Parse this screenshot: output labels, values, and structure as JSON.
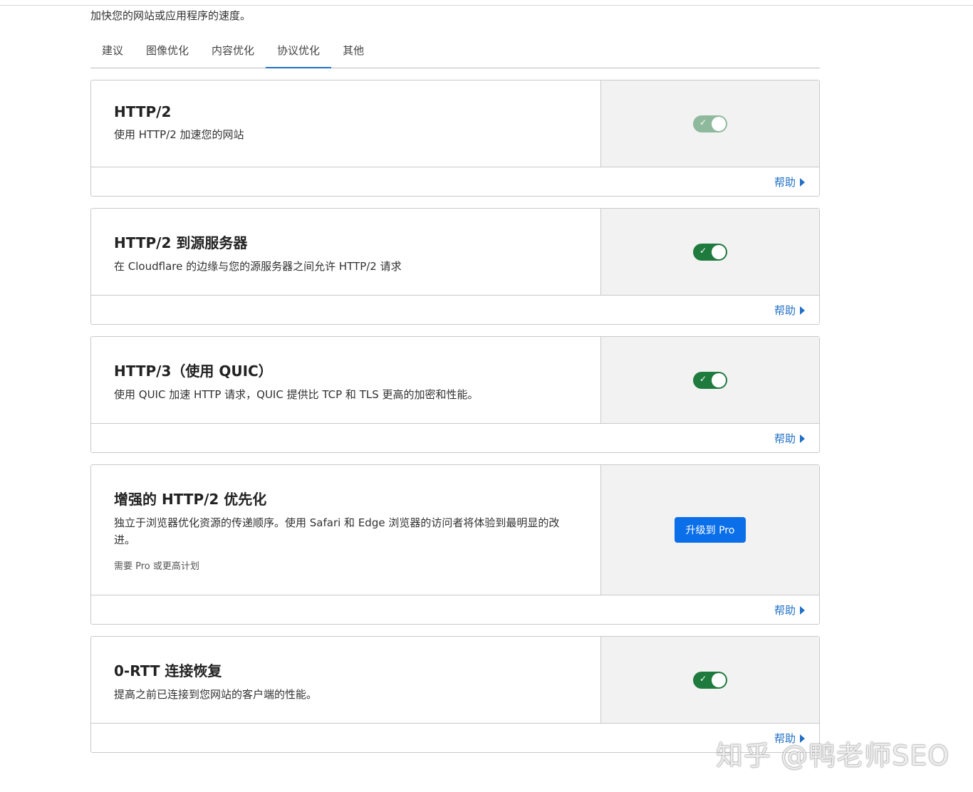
{
  "subtitle": "加快您的网站或应用程序的速度。",
  "tabs": [
    {
      "label": "建议"
    },
    {
      "label": "图像优化"
    },
    {
      "label": "内容优化"
    },
    {
      "label": "协议优化"
    },
    {
      "label": "其他"
    }
  ],
  "help_label": "帮助",
  "cards": [
    {
      "title": "HTTP/2",
      "desc": "使用 HTTP/2 加速您的网站",
      "toggle": "on-disabled"
    },
    {
      "title": "HTTP/2 到源服务器",
      "desc": "在 Cloudflare 的边缘与您的源服务器之间允许 HTTP/2 请求",
      "toggle": "on"
    },
    {
      "title": "HTTP/3（使用 QUIC）",
      "desc": "使用 QUIC 加速 HTTP 请求，QUIC 提供比 TCP 和 TLS 更高的加密和性能。",
      "toggle": "on"
    },
    {
      "title": "增强的 HTTP/2 优先化",
      "desc": "独立于浏览器优化资源的传递顺序。使用 Safari 和 Edge 浏览器的访问者将体验到最明显的改进。",
      "note": "需要 Pro 或更高计划",
      "button": "升级到 Pro"
    },
    {
      "title": "0-RTT 连接恢复",
      "desc": "提高之前已连接到您网站的客户端的性能。",
      "toggle": "on"
    }
  ],
  "watermark": "知乎 @鸭老师SEO"
}
